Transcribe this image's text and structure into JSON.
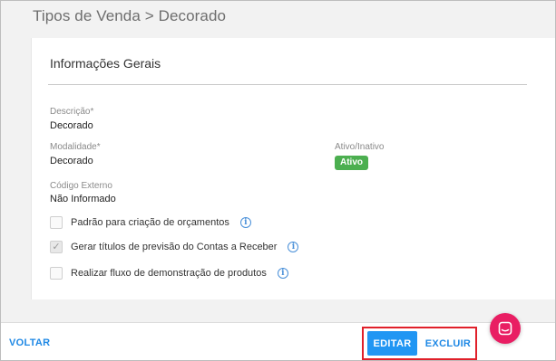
{
  "header": {
    "title": "Tipos de Venda > Decorado"
  },
  "card": {
    "section_title": "Informações Gerais",
    "fields": {
      "descricao": {
        "label": "Descrição*",
        "value": "Decorado"
      },
      "modalidade": {
        "label": "Modalidade*",
        "value": "Decorado"
      },
      "ativo": {
        "label": "Ativo/Inativo",
        "badge": "Ativo",
        "badge_color": "#4caf50"
      },
      "codigo_externo": {
        "label": "Código Externo",
        "value": "Não Informado"
      }
    },
    "checkboxes": [
      {
        "label": "Padrão para criação de orçamentos",
        "checked": false
      },
      {
        "label": "Gerar títulos de previsão do Contas a Receber",
        "checked": true
      },
      {
        "label": "Realizar fluxo de demonstração de produtos",
        "checked": false
      }
    ]
  },
  "footer": {
    "back_label": "VOLTAR",
    "edit_label": "EDITAR",
    "delete_label": "EXCLUIR",
    "accent_color": "#2196f3",
    "highlight_color": "#e0202a"
  },
  "chat": {
    "icon": "chat-icon",
    "color": "#e91e63"
  }
}
